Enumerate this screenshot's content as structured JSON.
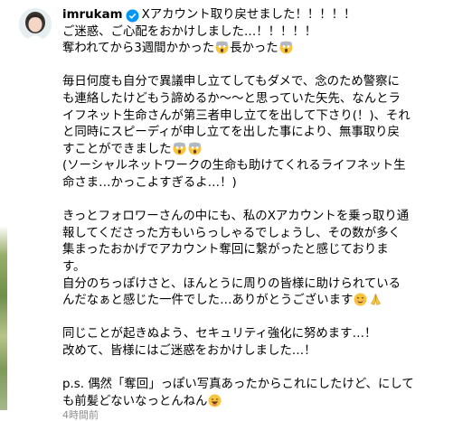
{
  "post": {
    "username": "imrukam",
    "header_text": "Xアカウント取り戻せました！！！！！",
    "lines": [
      "ご迷惑、ご心配をおかけしました…！！！！！",
      "奪われてから3週間かかった",
      "長かった"
    ],
    "para2": [
      "毎日何度も自分で異議申し立てしてもダメで、念のため警察に",
      "も連絡したけどもう諦めるか〜〜と思っていた矢先、なんとラ",
      "イフネット生命さんが第三者申し立てを出して下さり(！)、それ",
      "と同時にスピーディが申し立てを出した事により、無事取り戻",
      "すことができました",
      "(ソーシャルネットワークの生命も助けてくれるライフネット生",
      "命さま…かっこよすぎるよ…！)"
    ],
    "para3": [
      "きっとフォロワーさんの中にも、私のXアカウントを乗っ取り通",
      "報してくださった方もいらっしゃるでしょうし、その数が多く",
      "集まったおかげでアカウント奪回に繋がったと感じておりま",
      "す。",
      "自分のちっぽけさと、ほんとうに周りの皆様に助けられている",
      "んだなぁと感じた一件でした…ありがとうございます"
    ],
    "para4": [
      "同じことが起きぬよう、セキュリティ強化に努めます…！",
      "改めて、皆様にはご迷惑をおかけしました…！"
    ],
    "para5": [
      "p.s. 偶然「奪回」っぽい写真あったからこれにしたけど、にして",
      "も前髪どないなっとんねん"
    ],
    "footer": "4時間前"
  },
  "icons": {
    "verified": "verified-badge-icon",
    "avatar": "user-avatar",
    "scream": "screaming-face-emoji",
    "smile": "smiling-face-emoji",
    "pray": "folded-hands-emoji",
    "grin": "grinning-face-emoji"
  },
  "colors": {
    "verified": "#0095f6",
    "text": "#000000",
    "emoji": "#f7c53b"
  }
}
